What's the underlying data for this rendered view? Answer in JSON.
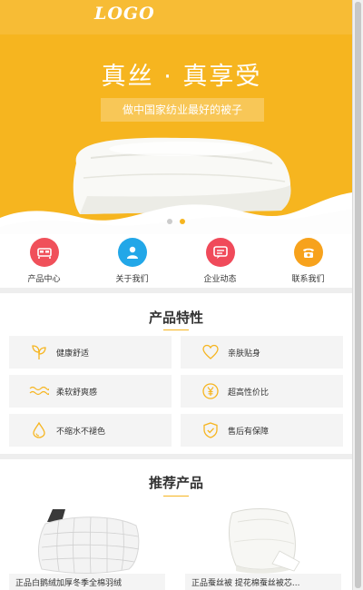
{
  "header": {
    "logo": "LOGO"
  },
  "banner": {
    "headline": "真丝 · 真享受",
    "subline": "做中国家纺业最好的被子",
    "slides": 2,
    "active_slide": 2
  },
  "nav": [
    {
      "label": "产品中心",
      "icon": "bed-icon",
      "color": "#f0505a"
    },
    {
      "label": "关于我们",
      "icon": "people-icon",
      "color": "#22a7e8"
    },
    {
      "label": "企业动态",
      "icon": "chat-icon",
      "color": "#f04a5a"
    },
    {
      "label": "联系我们",
      "icon": "phone-icon",
      "color": "#f7a21c"
    }
  ],
  "features": {
    "title": "产品特性",
    "items": [
      {
        "label": "健康舒适",
        "icon": "leaf-icon"
      },
      {
        "label": "亲肤贴身",
        "icon": "heart-icon"
      },
      {
        "label": "柔软舒爽感",
        "icon": "wave-icon"
      },
      {
        "label": "超高性价比",
        "icon": "yen-icon"
      },
      {
        "label": "不缩水不褪色",
        "icon": "water-drop-icon"
      },
      {
        "label": "售后有保障",
        "icon": "shield-check-icon"
      }
    ]
  },
  "products": {
    "title": "推荐产品",
    "items": [
      {
        "name": "正品白鹅绒加厚冬季全棉羽绒"
      },
      {
        "name": "正品蚕丝被 提花棉蚕丝被芯..."
      }
    ]
  },
  "colors": {
    "accent": "#f6b51f",
    "background": "#ffffff",
    "card": "#f4f4f4"
  }
}
